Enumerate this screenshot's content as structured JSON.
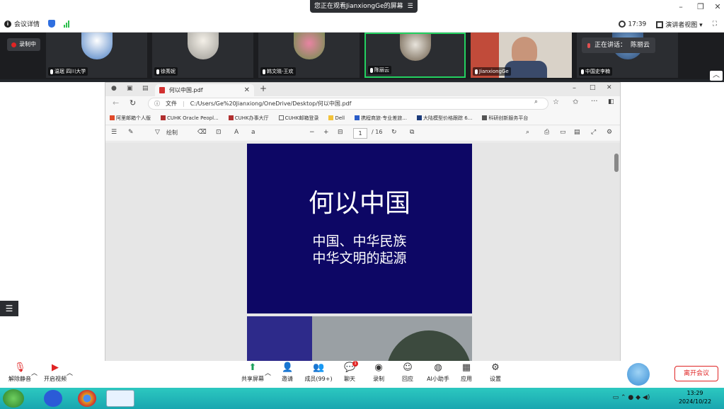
{
  "titlebar": {
    "share_banner": "您正在观看JianxiongGe的屏幕",
    "banner_menu_icon": "menu-icon"
  },
  "infobar": {
    "meeting_info": "会议详情",
    "timer": "17:39",
    "view_mode": "演讲者视图"
  },
  "strip": {
    "recording": "录制中",
    "speaking_label": "正在讲话：",
    "speaking_name": "陈丽云",
    "participants": [
      {
        "name": "温珉 四川大学"
      },
      {
        "name": "徐莠妮"
      },
      {
        "name": "韩文晓-王欢"
      },
      {
        "name": "陈丽云"
      },
      {
        "name": "JianxiongGe"
      },
      {
        "name": "中国史李楠"
      }
    ]
  },
  "browser": {
    "tab_title": "何以中国.pdf",
    "url_prefix": "文件",
    "url": "C:/Users/Ge%20Jianxiong/OneDrive/Desktop/何以中国.pdf",
    "bookmarks": [
      "阿里邮箱个人版",
      "CUHK Oracle Peopl...",
      "CUHK办事大厅",
      "CUHK邮箱登录",
      "Dell",
      "携程商旅·专业差旅...",
      "大陆模型价格跟踪 6...",
      "科研创新服务平台"
    ],
    "pdf_toolbar": {
      "draw": "绘制",
      "page_current": "1",
      "page_total": "/ 16"
    }
  },
  "pdf": {
    "slide_title": "何以中国",
    "slide_subtitle_line1": "中国、中华民族",
    "slide_subtitle_line2": "中华文明的起源"
  },
  "toolbar": {
    "unmute": "解除静音",
    "start_video": "开启视频",
    "share_screen": "共享屏幕",
    "invite": "邀请",
    "participants": "成员(99+)",
    "chat": "聊天",
    "chat_badge": "1",
    "record": "录制",
    "reactions": "回应",
    "ai_assistant": "AI小助手",
    "apps": "应用",
    "settings": "设置",
    "leave": "离开会议"
  },
  "taskbar": {
    "time": "13:29",
    "date": "2024/10/22"
  },
  "colors": {
    "slide_bg": "#0d0765",
    "active_border": "#23d160",
    "leave_red": "#e02424",
    "taskbar": "#1fb6b8"
  }
}
